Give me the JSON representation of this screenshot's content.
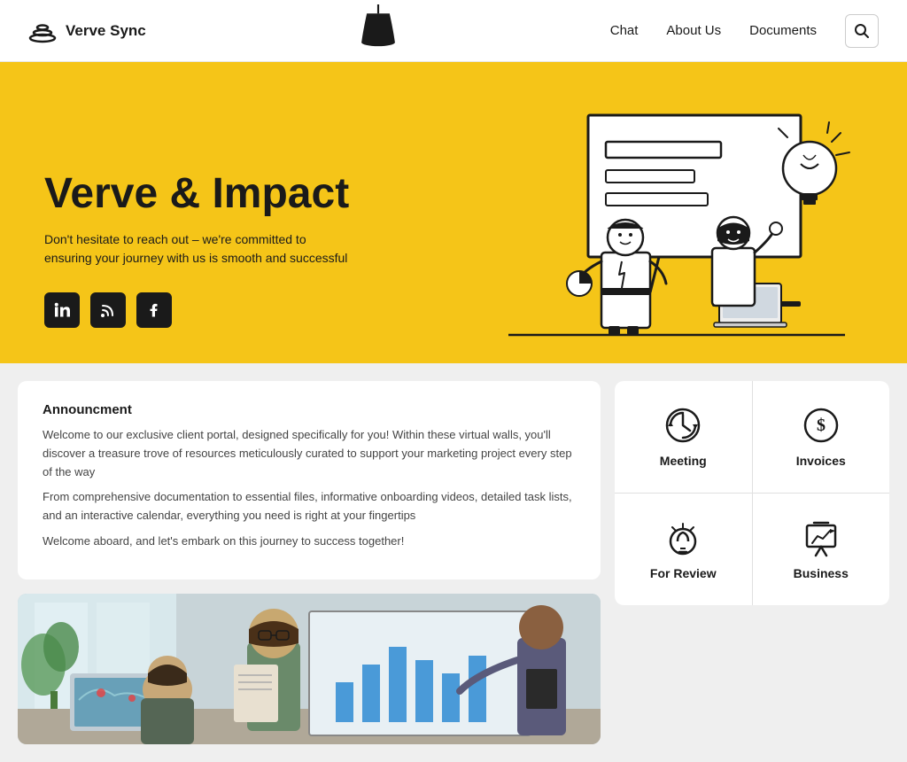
{
  "brand": {
    "name": "Verve Sync",
    "logo_alt": "Verve Sync logo"
  },
  "nav": {
    "links": [
      {
        "label": "Chat",
        "id": "chat"
      },
      {
        "label": "About Us",
        "id": "about-us"
      },
      {
        "label": "Documents",
        "id": "documents"
      }
    ],
    "search_label": "Search"
  },
  "hero": {
    "title": "Verve & Impact",
    "subtitle": "Don't hesitate to reach out – we're committed to ensuring your journey with us is smooth and successful",
    "socials": [
      {
        "name": "LinkedIn",
        "icon": "in",
        "id": "linkedin"
      },
      {
        "name": "RSS",
        "icon": "◉",
        "id": "rss"
      },
      {
        "name": "Facebook",
        "icon": "f",
        "id": "facebook"
      }
    ]
  },
  "announcement": {
    "title": "Announcment",
    "paragraphs": [
      "Welcome to our exclusive client portal, designed specifically for you! Within these virtual walls, you'll discover a treasure trove of resources meticulously curated to support your marketing project every step of the way",
      "From comprehensive documentation to essential files, informative onboarding videos, detailed task lists, and an interactive calendar, everything you need is right at your fingertips",
      "Welcome aboard, and let's embark on this journey to success together!"
    ]
  },
  "grid_items": [
    {
      "label": "Meeting",
      "icon_type": "clock",
      "id": "meeting"
    },
    {
      "label": "Invoices",
      "icon_type": "dollar",
      "id": "invoices"
    },
    {
      "label": "For Review",
      "icon_type": "lightbulb",
      "id": "for-review"
    },
    {
      "label": "Business",
      "icon_type": "chart",
      "id": "business"
    }
  ],
  "colors": {
    "hero_bg": "#F5C518",
    "accent_dark": "#1a1a1a",
    "white": "#ffffff",
    "bg": "#efefef"
  }
}
